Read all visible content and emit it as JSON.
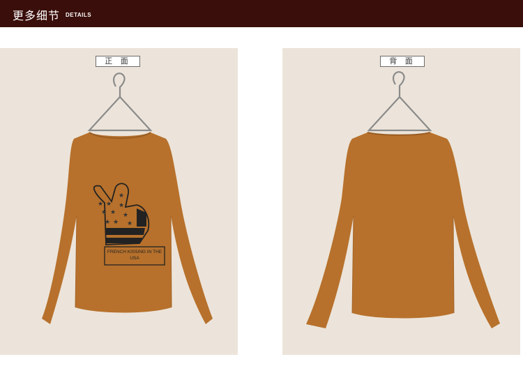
{
  "header": {
    "title": "更多细节",
    "subtitle": "DETAILS"
  },
  "panels": {
    "front": {
      "label": "正 面",
      "print_text": "FRENCH KISSING IN THE USA"
    },
    "back": {
      "label": "背 面"
    }
  },
  "colors": {
    "header_bg": "#3a0e0a",
    "panel_bg": "#ece4da",
    "garment": "#b7712c"
  },
  "icons": {
    "hanger": "hanger-icon",
    "print": "peace-hand-flag-print"
  }
}
